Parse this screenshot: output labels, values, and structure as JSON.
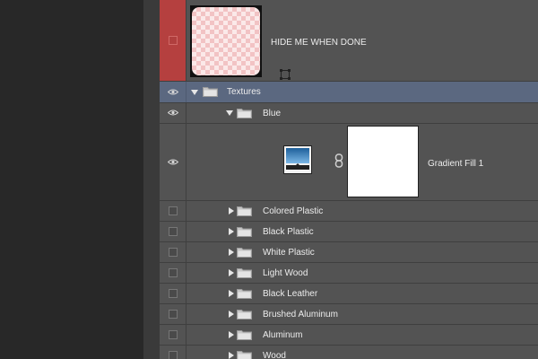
{
  "layers": {
    "hide_layer": {
      "name": "HIDE ME WHEN DONE"
    },
    "textures_group": {
      "name": "Textures"
    },
    "blue_group": {
      "name": "Blue"
    },
    "gradient_layer": {
      "name": "Gradient Fill 1"
    },
    "subgroups": [
      {
        "name": "Colored Plastic"
      },
      {
        "name": "Black Plastic"
      },
      {
        "name": "White Plastic"
      },
      {
        "name": "Light Wood"
      },
      {
        "name": "Black Leather"
      },
      {
        "name": "Brushed Aluminum"
      },
      {
        "name": "Aluminum"
      },
      {
        "name": "Wood"
      }
    ]
  },
  "colors": {
    "panel_bg": "#535353",
    "selected_row": "#5b6880",
    "red_label": "#b5403f"
  },
  "icons": [
    "eye-icon",
    "folder-icon",
    "link-icon",
    "layer-mask-icon",
    "gradient-fill-icon"
  ]
}
